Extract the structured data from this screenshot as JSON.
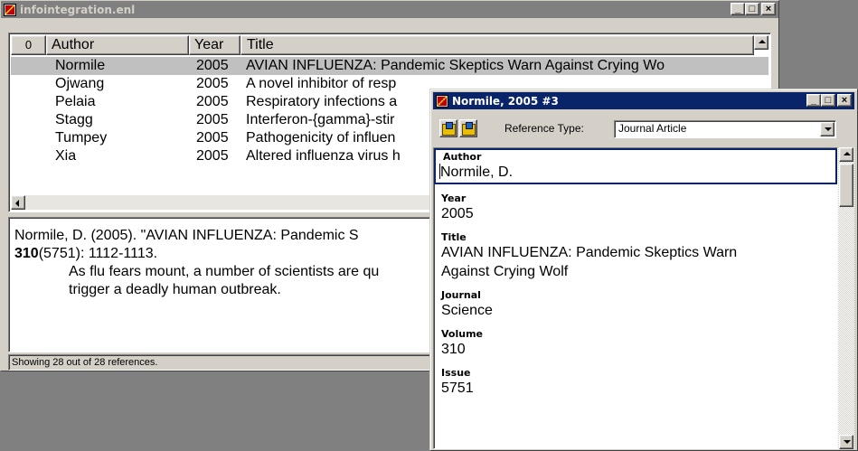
{
  "main_window": {
    "title": "infointegration.enl",
    "buttons": {
      "minimize": "_",
      "maximize": "□",
      "close": "×"
    },
    "columns": {
      "attachment": "0",
      "author": "Author",
      "year": "Year",
      "title": "Title"
    },
    "rows": [
      {
        "author": "Normile",
        "year": "2005",
        "title": "AVIAN INFLUENZA: Pandemic Skeptics Warn Against Crying Wo"
      },
      {
        "author": "Ojwang",
        "year": "2005",
        "title": "A novel inhibitor of resp"
      },
      {
        "author": "Pelaia",
        "year": "2005",
        "title": "Respiratory infections a"
      },
      {
        "author": "Stagg",
        "year": "2005",
        "title": "Interferon-{gamma}-stir"
      },
      {
        "author": "Tumpey",
        "year": "2005",
        "title": "Pathogenicity of influen"
      },
      {
        "author": "Xia",
        "year": "2005",
        "title": "Altered influenza virus h"
      }
    ],
    "preview": {
      "line1": "Normile, D. (2005). \"AVIAN INFLUENZA: Pandemic S",
      "volume_bold": "310",
      "line2_rest": "(5751): 1112-1113.",
      "abstract_line1": "As flu fears mount, a number of scientists are qu",
      "abstract_line2": "trigger a deadly human outbreak."
    },
    "status": "Showing 28 out of 28 references."
  },
  "ref_window": {
    "title": "Normile, 2005 #3",
    "reference_type_label": "Reference Type:",
    "reference_type_value": "Journal Article",
    "fields": [
      {
        "label": "Author",
        "value": "Normile, D."
      },
      {
        "label": "Year",
        "value": "2005"
      },
      {
        "label": "Title",
        "value": "AVIAN INFLUENZA: Pandemic Skeptics Warn\nAgainst Crying Wolf"
      },
      {
        "label": "Journal",
        "value": "Science"
      },
      {
        "label": "Volume",
        "value": "310"
      },
      {
        "label": "Issue",
        "value": "5751"
      }
    ]
  }
}
